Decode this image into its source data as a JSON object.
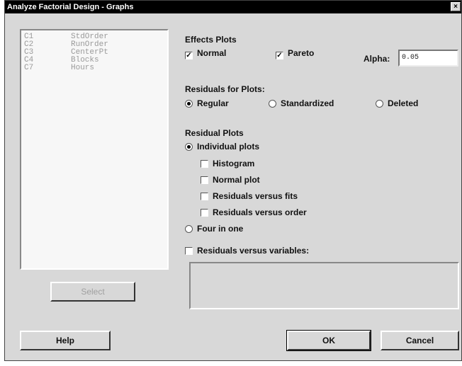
{
  "window": {
    "title": "Analyze Factorial Design - Graphs",
    "close": "×"
  },
  "variables": [
    {
      "col": "C1",
      "name": "StdOrder"
    },
    {
      "col": "C2",
      "name": "RunOrder"
    },
    {
      "col": "C3",
      "name": "CenterPt"
    },
    {
      "col": "C4",
      "name": "Blocks"
    },
    {
      "col": "C7",
      "name": "Hours"
    }
  ],
  "effects": {
    "heading": "Effects Plots",
    "normal": {
      "label": "Normal",
      "checked": true
    },
    "pareto": {
      "label": "Pareto",
      "checked": true
    },
    "alpha_label": "Alpha:",
    "alpha_value": "0.05"
  },
  "residuals_for_plots": {
    "heading": "Residuals for Plots:",
    "options": [
      "Regular",
      "Standardized",
      "Deleted"
    ],
    "selected": "Regular"
  },
  "residual_plots": {
    "heading": "Residual Plots",
    "individual": "Individual plots",
    "histogram": "Histogram",
    "normal_plot": "Normal plot",
    "vs_fits": "Residuals versus fits",
    "vs_order": "Residuals versus order",
    "four_in_one": "Four in one",
    "selected": "Individual plots"
  },
  "vs_variables": {
    "label": "Residuals versus variables:",
    "value": ""
  },
  "buttons": {
    "select": "Select",
    "help": "Help",
    "ok": "OK",
    "cancel": "Cancel"
  }
}
